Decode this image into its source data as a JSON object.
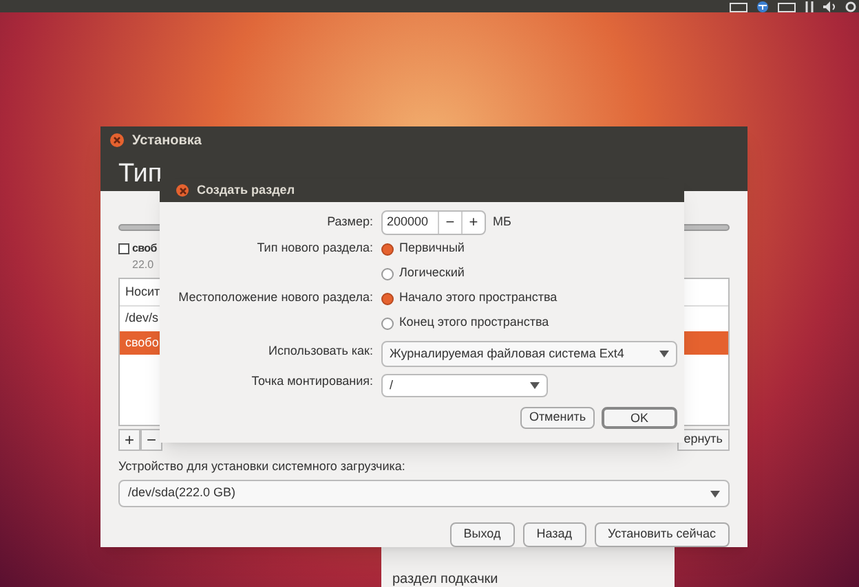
{
  "installer": {
    "title": "Установка",
    "heading": "Тип",
    "partition": {
      "label": "своб",
      "size": "22.0",
      "checked": false
    },
    "table": {
      "header": "Носит",
      "rows": [
        {
          "text": "/dev/s",
          "selected": false
        },
        {
          "text": "свобо",
          "selected": true
        }
      ]
    },
    "add_button": "+",
    "remove_button": "−",
    "revert_button": "ернуть",
    "bootloader_label": "Устройство для установки системного загрузчика:",
    "bootloader_device": "/dev/sda(222.0 GB)",
    "buttons": [
      "Выход",
      "Назад",
      "Установить сейчас"
    ]
  },
  "dropdown": {
    "items": [
      "раздел подкачки"
    ]
  },
  "dialog": {
    "title": "Создать раздел",
    "size_label": "Размер:",
    "size_value": "200000",
    "minus": "−",
    "plus": "+",
    "unit": "МБ",
    "type_label": "Тип нового раздела:",
    "type_options": [
      {
        "label": "Первичный",
        "selected": true
      },
      {
        "label": "Логический",
        "selected": false
      }
    ],
    "location_label": "Местоположение нового раздела:",
    "location_options": [
      {
        "label": "Начало этого пространства",
        "selected": true
      },
      {
        "label": "Конец этого пространства",
        "selected": false
      }
    ],
    "use_as_label": "Использовать как:",
    "use_as_value": "Журналируемая файловая система Ext4",
    "mount_label": "Точка монтирования:",
    "mount_value": "/",
    "buttons": [
      {
        "label": "Отменить",
        "default": false
      },
      {
        "label": "OK",
        "default": true
      }
    ]
  }
}
